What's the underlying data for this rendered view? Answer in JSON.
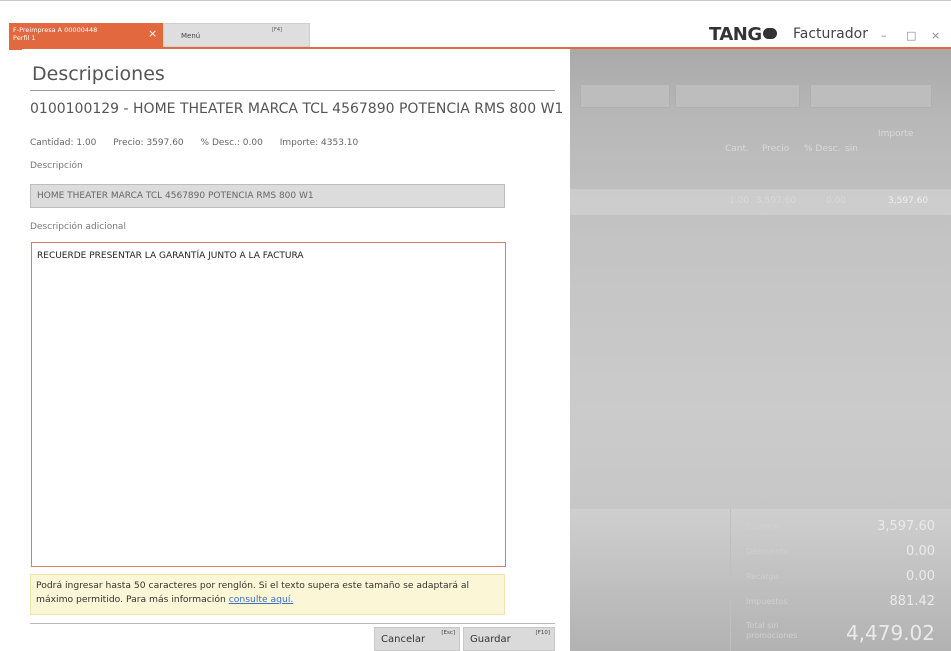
{
  "tabs": {
    "active_line1": "F-Preimpresa A 00000448",
    "active_line2": "Perfil 1",
    "close_glyph": "×",
    "menu_label": "Menú",
    "menu_hotkey": "[F4]"
  },
  "app": {
    "logo_text_1": "TAN",
    "logo_text_2": "G",
    "name": "Facturador",
    "minimize": "–",
    "maximize": "□",
    "close": "×"
  },
  "dialog": {
    "title": "Descripciones",
    "product": "0100100129  -  HOME THEATER MARCA TCL 4567890 POTENCIA  RMS 800 W1",
    "cantidad": "Cantidad: 1.00",
    "precio": "Precio: 3597.60",
    "desc": "% Desc.: 0.00",
    "importe": "Importe: 4353.10",
    "descripcion_label": "Descripción",
    "descripcion_value": "HOME THEATER MARCA TCL 4567890 POTENCIA  RMS 800 W1",
    "adicional_label": "Descripción adicional",
    "adicional_value": "RECUERDE PRESENTAR LA GARANTÍA JUNTO A LA FACTURA",
    "notice_text": "Podrá ingresar hasta 50 caracteres por renglón. Si el texto supera este tamaño se adaptará al máximo permitido. Para más información ",
    "notice_link": "consulte aquí.",
    "cancel_label": "Cancelar",
    "cancel_hotkey": "[Esc]",
    "save_label": "Guardar",
    "save_hotkey": "[F10]"
  },
  "background": {
    "grid_headers": {
      "cant": "Cant.",
      "precio": "Precio",
      "desc": "% Desc.",
      "importe": "Importe",
      "importe_sub": "sin"
    },
    "row": {
      "cant": "1.00",
      "precio": "3,597.60",
      "desc": "0.00",
      "importe": "3,597.60"
    },
    "totals": [
      {
        "label": "Subtotal",
        "value": "3,597.60"
      },
      {
        "label": "Descuento",
        "value": "0.00"
      },
      {
        "label": "Recargo",
        "value": "0.00"
      },
      {
        "label": "Impuestos",
        "value": "881.42"
      },
      {
        "label": "Total sin promociones",
        "value": "4,479.02"
      }
    ]
  },
  "colors": {
    "accent": "#e2683f",
    "notice_bg": "#fbf6d6",
    "link": "#3b6ec5"
  }
}
